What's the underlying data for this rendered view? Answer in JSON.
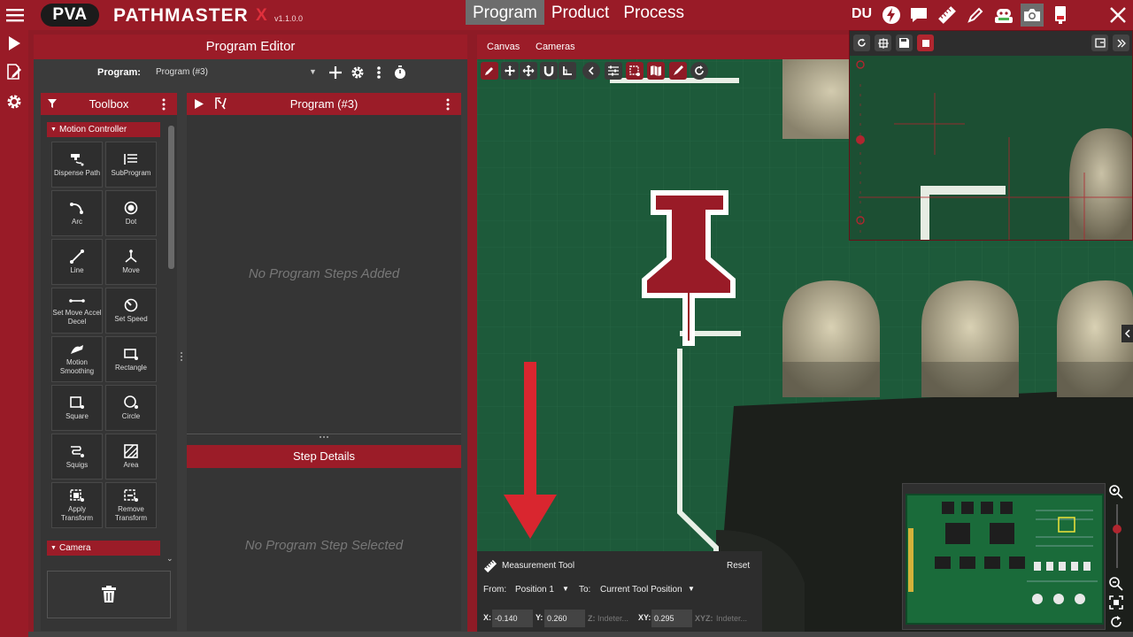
{
  "app": {
    "logo_mark": "PVA",
    "name": "PATHMASTER",
    "name_suffix": "X",
    "version": "v1.1.0.0",
    "user_initials": "DU"
  },
  "top_tabs": [
    {
      "label": "Program",
      "active": true
    },
    {
      "label": "Product",
      "active": false
    },
    {
      "label": "Process",
      "active": false
    }
  ],
  "top_icons": [
    "lightning-icon",
    "chat-icon",
    "ruler-icon",
    "pen-icon",
    "robot-icon",
    "camera-icon",
    "device-icon",
    "close-icon"
  ],
  "rail_icons": [
    "play-icon",
    "edit-document-icon",
    "gear-icon"
  ],
  "editor": {
    "title": "Program Editor",
    "program_label": "Program:",
    "program_value": "Program (#3)"
  },
  "toolbox": {
    "title": "Toolbox",
    "groups": [
      {
        "name": "Motion Controller",
        "tools": [
          {
            "label": "Dispense Path",
            "icon": "dispense-path-icon"
          },
          {
            "label": "SubProgram",
            "icon": "subprogram-icon"
          },
          {
            "label": "Arc",
            "icon": "arc-icon"
          },
          {
            "label": "Dot",
            "icon": "dot-icon"
          },
          {
            "label": "Line",
            "icon": "line-icon"
          },
          {
            "label": "Move",
            "icon": "move-icon"
          },
          {
            "label": "Set Move Accel Decel",
            "icon": "accel-icon"
          },
          {
            "label": "Set Speed",
            "icon": "speed-icon"
          },
          {
            "label": "Motion Smoothing",
            "icon": "smoothing-icon"
          },
          {
            "label": "Rectangle",
            "icon": "rectangle-icon"
          },
          {
            "label": "Square",
            "icon": "square-icon"
          },
          {
            "label": "Circle",
            "icon": "circle-icon"
          },
          {
            "label": "Squigs",
            "icon": "squigs-icon"
          },
          {
            "label": "Area",
            "icon": "area-icon"
          },
          {
            "label": "Apply Transform",
            "icon": "apply-transform-icon"
          },
          {
            "label": "Remove Transform",
            "icon": "remove-transform-icon"
          }
        ]
      },
      {
        "name": "Camera",
        "tools": []
      }
    ]
  },
  "program_panel": {
    "title": "Program (#3)",
    "empty_text": "No Program Steps Added",
    "details_title": "Step Details",
    "details_empty": "No Program Step Selected"
  },
  "canvas": {
    "tabs": [
      "Canvas",
      "Cameras"
    ],
    "toolbar": [
      "pencil-icon",
      "move-icon",
      "pan-icon",
      "magnet-icon",
      "corner-icon",
      "chevron-left-icon",
      "sliders-icon",
      "transform-icon",
      "map-icon",
      "brush-icon",
      "refresh-icon"
    ]
  },
  "measurement": {
    "title": "Measurement Tool",
    "reset": "Reset",
    "from_label": "From:",
    "from_value": "Position 1",
    "to_label": "To:",
    "to_value": "Current Tool Position",
    "x_label": "X:",
    "x_value": "-0.140",
    "y_label": "Y:",
    "y_value": "0.260",
    "z_label": "Z:",
    "z_value": "Indeter...",
    "xy_label": "XY:",
    "xy_value": "0.295",
    "xyz_label": "XYZ:",
    "xyz_value": "Indeter..."
  },
  "colors": {
    "brand_red": "#991b27",
    "panel_dark": "#353535",
    "pcb_green": "#1d5a3a"
  }
}
